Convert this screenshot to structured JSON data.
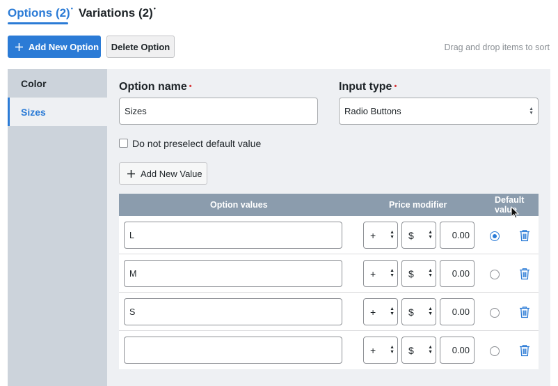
{
  "tabs": {
    "options_label": "Options (2)",
    "options_marker": "•",
    "variations_label": "Variations (2)",
    "variations_marker": "•"
  },
  "toolbar": {
    "add_option_label": "Add New Option",
    "delete_option_label": "Delete Option",
    "sort_hint": "Drag and drop items to sort"
  },
  "sidebar": {
    "items": [
      {
        "label": "Color",
        "active": false
      },
      {
        "label": "Sizes",
        "active": true
      }
    ]
  },
  "form": {
    "option_name_label": "Option name",
    "option_name_value": "Sizes",
    "input_type_label": "Input type",
    "input_type_value": "Radio Buttons",
    "required_marker": "•",
    "preselect_label": "Do not preselect default value",
    "preselect_checked": false,
    "add_value_label": "Add New Value"
  },
  "table": {
    "headers": {
      "values": "Option values",
      "price": "Price modifier",
      "default_line1": "Default",
      "default_line2": "value"
    },
    "rows": [
      {
        "value": "L",
        "sign": "+",
        "currency": "$",
        "amount": "0.00",
        "default": true
      },
      {
        "value": "M",
        "sign": "+",
        "currency": "$",
        "amount": "0.00",
        "default": false
      },
      {
        "value": "S",
        "sign": "+",
        "currency": "$",
        "amount": "0.00",
        "default": false
      },
      {
        "value": "",
        "sign": "+",
        "currency": "$",
        "amount": "0.00",
        "default": false
      }
    ]
  },
  "colors": {
    "accent": "#2b7bd6",
    "required": "#d63638",
    "table_header": "#8b9cad"
  },
  "icons": [
    "plus-icon",
    "trash-icon",
    "select-arrows-icon",
    "mouse-cursor-icon"
  ]
}
